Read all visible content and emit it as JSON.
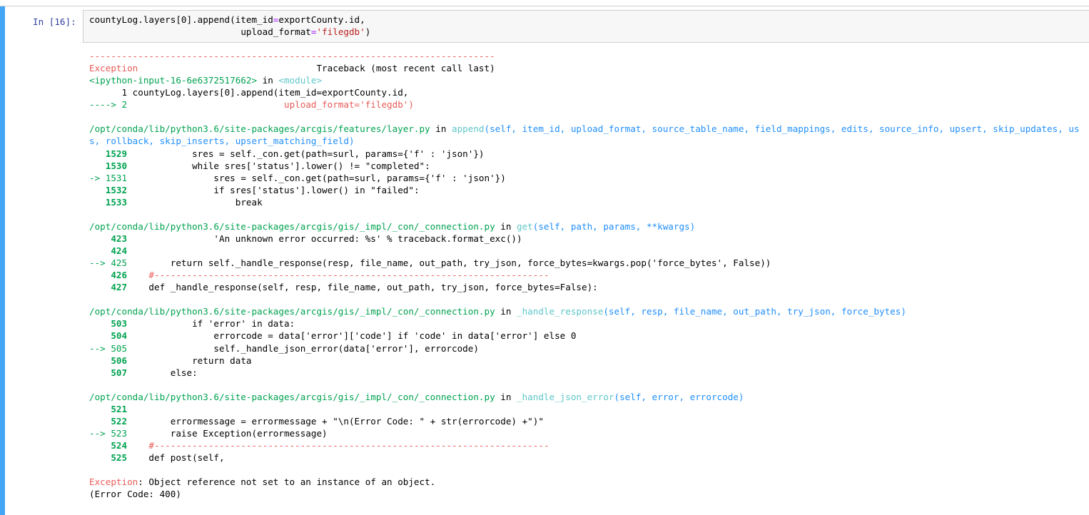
{
  "prompt": "In [16]:",
  "code": {
    "line1": {
      "pre": "countyLog.layers[0].append(item_id",
      "op": "=",
      "post": "exportCounty.id,"
    },
    "line2": {
      "indent": "                            ",
      "kw": "upload_format",
      "op": "=",
      "str": "'filegdb'",
      "post": ")"
    }
  },
  "trace": {
    "dashes": "---------------------------------------------------------------------------",
    "exc_name": "Exception",
    "exc_pad": "                                 ",
    "traceback_label": "Traceback (most recent call last)",
    "input_ref": "<ipython-input-16-6e6372517662>",
    "in_word": " in ",
    "module": "<module>",
    "f0": [
      {
        "arrow": "      ",
        "num": "1",
        "code": " countyLog.layers[0].append(item_id=exportCounty.id,",
        "red": ""
      },
      {
        "arrow": "----> ",
        "num": "2",
        "code": "                             ",
        "red": "upload_format='filegdb')"
      }
    ],
    "f1": {
      "path": "/opt/conda/lib/python3.6/site-packages/arcgis/features/layer.py",
      "in": " in ",
      "func": "append",
      "sig1": "(self, item_id, upload_format, source_table_name, field_mappings, edits, source_info, upsert, skip_updates, us",
      "sig2": "s, rollback, skip_inserts, upsert_matching_field)",
      "lines": [
        {
          "arrow": "   ",
          "num": "1529",
          "code": "            sres = self._con.get(path=surl, params={'f' : 'json'})"
        },
        {
          "arrow": "   ",
          "num": "1530",
          "code": "            while sres['status'].lower() != \"completed\":"
        },
        {
          "arrow": "-> ",
          "num": "1531",
          "code": "                sres = self._con.get(path=surl, params={'f' : 'json'})"
        },
        {
          "arrow": "   ",
          "num": "1532",
          "code": "                if sres['status'].lower() in \"failed\":"
        },
        {
          "arrow": "   ",
          "num": "1533",
          "code": "                    break"
        }
      ]
    },
    "f2": {
      "path": "/opt/conda/lib/python3.6/site-packages/arcgis/gis/_impl/_con/_connection.py",
      "in": " in ",
      "func": "get",
      "sig1": "(self, path, params, **kwargs)",
      "lines": [
        {
          "arrow": "    ",
          "num": "423",
          "code": "                'An unknown error occurred: %s' % traceback.format_exc())"
        },
        {
          "arrow": "    ",
          "num": "424",
          "code": ""
        },
        {
          "arrow": "--> ",
          "num": "425",
          "code": "        return self._handle_response(resp, file_name, out_path, try_json, force_bytes=kwargs.pop('force_bytes', False))"
        },
        {
          "arrow": "    ",
          "num": "426",
          "code": "    #-------------------------------------------------------------------------"
        },
        {
          "arrow": "    ",
          "num": "427",
          "code": "    def _handle_response(self, resp, file_name, out_path, try_json, force_bytes=False):"
        }
      ]
    },
    "f3": {
      "path": "/opt/conda/lib/python3.6/site-packages/arcgis/gis/_impl/_con/_connection.py",
      "in": " in ",
      "func": "_handle_response",
      "sig1": "(self, resp, file_name, out_path, try_json, force_bytes)",
      "lines": [
        {
          "arrow": "    ",
          "num": "503",
          "code": "            if 'error' in data:"
        },
        {
          "arrow": "    ",
          "num": "504",
          "code": "                errorcode = data['error']['code'] if 'code' in data['error'] else 0"
        },
        {
          "arrow": "--> ",
          "num": "505",
          "code": "                self._handle_json_error(data['error'], errorcode)"
        },
        {
          "arrow": "    ",
          "num": "506",
          "code": "            return data"
        },
        {
          "arrow": "    ",
          "num": "507",
          "code": "        else:"
        }
      ]
    },
    "f4": {
      "path": "/opt/conda/lib/python3.6/site-packages/arcgis/gis/_impl/_con/_connection.py",
      "in": " in ",
      "func": "_handle_json_error",
      "sig1": "(self, error, errorcode)",
      "lines": [
        {
          "arrow": "    ",
          "num": "521",
          "code": ""
        },
        {
          "arrow": "    ",
          "num": "522",
          "code": "        errormessage = errormessage + \"\\n(Error Code: \" + str(errorcode) +\")\""
        },
        {
          "arrow": "--> ",
          "num": "523",
          "code": "        raise Exception(errormessage)"
        },
        {
          "arrow": "    ",
          "num": "524",
          "code": "    #-------------------------------------------------------------------------"
        },
        {
          "arrow": "    ",
          "num": "525",
          "code": "    def post(self,"
        }
      ]
    },
    "final_exc": "Exception",
    "final_msg": ": Object reference not set to an instance of an object.",
    "final_code": "(Error Code: 400)"
  }
}
